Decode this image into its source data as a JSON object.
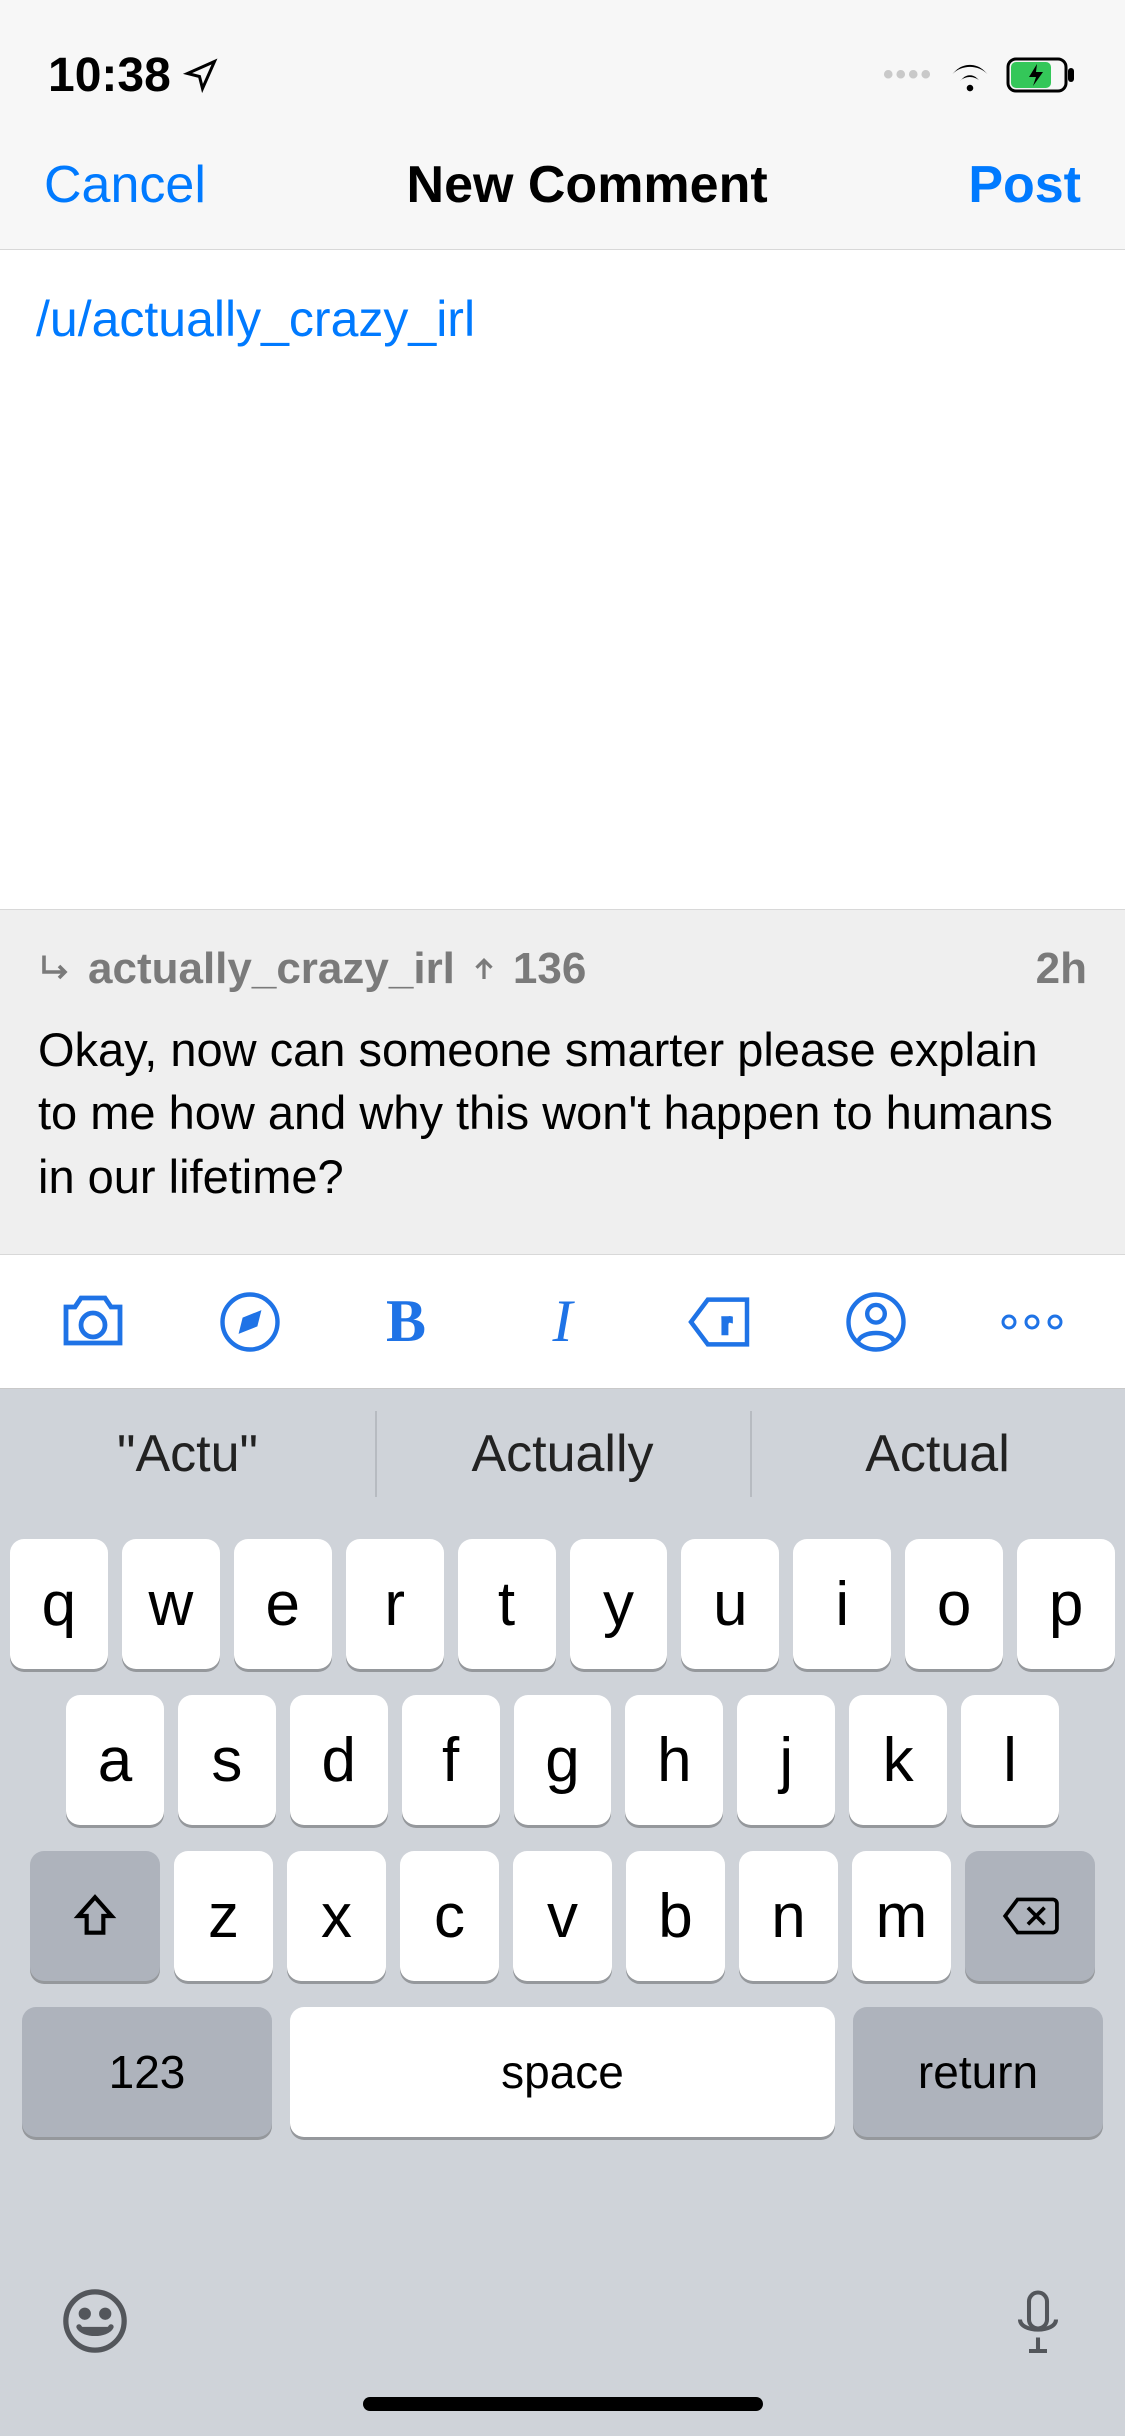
{
  "status": {
    "time": "10:38"
  },
  "nav": {
    "cancel": "Cancel",
    "title": "New Comment",
    "post": "Post"
  },
  "composer": {
    "mention": "/u/actually_crazy_irl"
  },
  "quoted": {
    "author": "actually_crazy_irl",
    "upvotes": "136",
    "age": "2h",
    "body": "Okay, now can someone smarter please explain to me how and why this won't happen to humans in our lifetime?"
  },
  "format": {
    "bold": "B",
    "italic": "I"
  },
  "suggestions": [
    "\"Actu\"",
    "Actually",
    "Actual"
  ],
  "keyboard": {
    "row1": [
      "q",
      "w",
      "e",
      "r",
      "t",
      "y",
      "u",
      "i",
      "o",
      "p"
    ],
    "row2": [
      "a",
      "s",
      "d",
      "f",
      "g",
      "h",
      "j",
      "k",
      "l"
    ],
    "row3": [
      "z",
      "x",
      "c",
      "v",
      "b",
      "n",
      "m"
    ],
    "k123": "123",
    "space": "space",
    "return": "return"
  }
}
